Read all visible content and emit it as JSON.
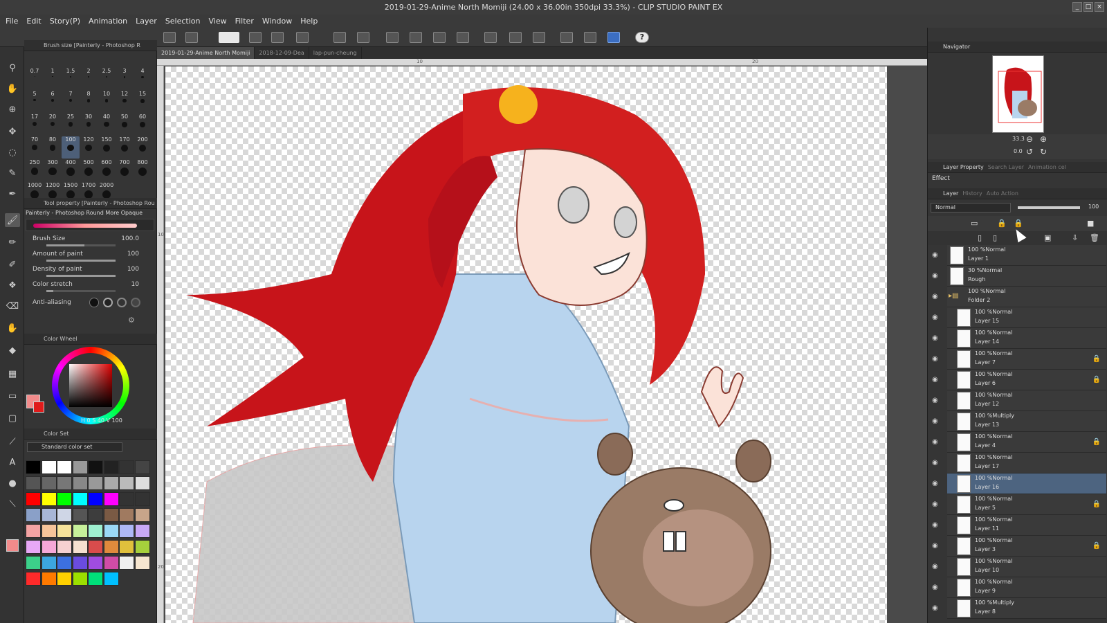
{
  "window": {
    "title": "2019-01-29-Anime North Momiji (24.00 x 36.00in 350dpi 33.3%) - CLIP STUDIO PAINT EX"
  },
  "menu": [
    "File",
    "Edit",
    "Story(P)",
    "Animation",
    "Layer",
    "Selection",
    "View",
    "Filter",
    "Window",
    "Help"
  ],
  "brush_size_panel": {
    "title": "Brush size [Painterly - Photoshop R",
    "sizes": [
      "0.7",
      "1",
      "1.5",
      "2",
      "2.5",
      "3",
      "4",
      "5",
      "6",
      "7",
      "8",
      "10",
      "12",
      "15",
      "17",
      "20",
      "25",
      "30",
      "40",
      "50",
      "60",
      "70",
      "80",
      "100",
      "120",
      "150",
      "170",
      "200",
      "250",
      "300",
      "400",
      "500",
      "600",
      "700",
      "800",
      "1000",
      "1200",
      "1500",
      "1700",
      "2000"
    ],
    "selected": "100"
  },
  "tool_property": {
    "title": "Tool property [Painterly - Photoshop Rou",
    "brush_name": "Painterly - Photoshop Round More Opaque",
    "rows": [
      {
        "label": "Brush Size",
        "value": "100.0",
        "fraction": 0.55
      },
      {
        "label": "Amount of paint",
        "value": "100",
        "fraction": 1.0
      },
      {
        "label": "Density of paint",
        "value": "100",
        "fraction": 1.0
      },
      {
        "label": "Color stretch",
        "value": "10",
        "fraction": 0.1
      }
    ],
    "antialias_label": "Anti-aliasing"
  },
  "color_wheel": {
    "title": "Color Wheel",
    "readout": "H 0  S 40  V 100"
  },
  "color_set": {
    "title": "Color Set",
    "set_name": "Standard color set"
  },
  "swatches": [
    "#000",
    "#fff",
    "#fff",
    "#999",
    "#111",
    "#222",
    "#333",
    "#444",
    "#555",
    "#666",
    "#777",
    "#888",
    "#999",
    "#aaa",
    "#bbb",
    "#ddd",
    "#ff0000",
    "#ffff00",
    "#00ff00",
    "#00ffff",
    "#0000ff",
    "#ff00ff",
    "#333",
    "#333",
    "#8aa0c8",
    "#a8b6d6",
    "#cfd6e6",
    "#555",
    "#3d3d3d",
    "#7a5a44",
    "#a07a60",
    "#c8a58a",
    "#f4a3a3",
    "#f6c49a",
    "#f6e29a",
    "#c6f09a",
    "#9ef0d0",
    "#9ad8f6",
    "#aeb8f6",
    "#c8a8f6",
    "#e8a8f6",
    "#f6a8d8",
    "#f6d0d0",
    "#f6e0d0",
    "#d94c4c",
    "#e08a3c",
    "#e0c03c",
    "#a6d03c",
    "#3cd08a",
    "#3ca6e0",
    "#3c70e0",
    "#6a4ce0",
    "#a04ce0",
    "#d04ca6",
    "#f0f0f0",
    "#f6e6d0",
    "#ff2a2a",
    "#ff7a00",
    "#ffd000",
    "#9be000",
    "#00e07a",
    "#00c0ff"
  ],
  "doc_tabs": [
    "2019-01-29-Anime North Momiji",
    "2018-12-09-Dea",
    "lap-pun-cheung"
  ],
  "ruler": {
    "h": [
      "10",
      "20"
    ],
    "v": [
      "10",
      "20"
    ]
  },
  "status": {
    "zoom": "33.3",
    "angle": "0.0"
  },
  "navigator": {
    "title": "Navigator",
    "zoom": "33.3",
    "angle": "0.0"
  },
  "layer_property": {
    "tabs": [
      "Layer Property",
      "Search Layer",
      "Animation cel"
    ],
    "effect_label": "Effect"
  },
  "layer_panel": {
    "tabs": [
      "Layer",
      "History",
      "Auto Action"
    ],
    "blend_mode": "Normal",
    "opacity": "100",
    "layers": [
      {
        "mode": "100 %Normal",
        "name": "Layer 1",
        "indent": 0,
        "lock": false
      },
      {
        "mode": "30 %Normal",
        "name": "Rough",
        "indent": 0,
        "lock": false
      },
      {
        "mode": "100 %Normal",
        "name": "Folder 2",
        "indent": 0,
        "lock": false,
        "folder": true
      },
      {
        "mode": "100 %Normal",
        "name": "Layer 15",
        "indent": 1,
        "lock": false
      },
      {
        "mode": "100 %Normal",
        "name": "Layer 14",
        "indent": 1,
        "lock": false
      },
      {
        "mode": "100 %Normal",
        "name": "Layer 7",
        "indent": 1,
        "lock": true
      },
      {
        "mode": "100 %Normal",
        "name": "Layer 6",
        "indent": 1,
        "lock": true
      },
      {
        "mode": "100 %Normal",
        "name": "Layer 12",
        "indent": 1,
        "lock": false
      },
      {
        "mode": "100 %Multiply",
        "name": "Layer 13",
        "indent": 1,
        "lock": false
      },
      {
        "mode": "100 %Normal",
        "name": "Layer 4",
        "indent": 1,
        "lock": true
      },
      {
        "mode": "100 %Normal",
        "name": "Layer 17",
        "indent": 1,
        "lock": false
      },
      {
        "mode": "100 %Normal",
        "name": "Layer 16",
        "indent": 1,
        "lock": false,
        "selected": true
      },
      {
        "mode": "100 %Normal",
        "name": "Layer 5",
        "indent": 1,
        "lock": true
      },
      {
        "mode": "100 %Normal",
        "name": "Layer 11",
        "indent": 1,
        "lock": false
      },
      {
        "mode": "100 %Normal",
        "name": "Layer 3",
        "indent": 1,
        "lock": true
      },
      {
        "mode": "100 %Normal",
        "name": "Layer 10",
        "indent": 1,
        "lock": false
      },
      {
        "mode": "100 %Normal",
        "name": "Layer 9",
        "indent": 1,
        "lock": false
      },
      {
        "mode": "100 %Multiply",
        "name": "Layer 8",
        "indent": 1,
        "lock": false
      }
    ]
  },
  "icons": [
    "pen-icon",
    "hand-icon",
    "zoom-icon",
    "move-icon",
    "lasso-icon",
    "eyedropper-icon",
    "brush-icon",
    "eraser-icon",
    "fill-icon",
    "gradient-icon",
    "shape-icon",
    "text-icon",
    "eye-icon",
    "lock-icon",
    "folder-icon",
    "trash-icon",
    "undo-icon",
    "redo-icon",
    "help-icon"
  ]
}
